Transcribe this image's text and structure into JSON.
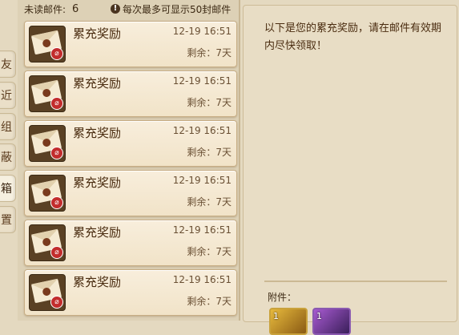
{
  "tabs": [
    {
      "label": "友",
      "active": false
    },
    {
      "label": "近",
      "active": false
    },
    {
      "label": "组",
      "active": false
    },
    {
      "label": "蔽",
      "active": false
    },
    {
      "label": "箱",
      "active": true
    },
    {
      "label": "置",
      "active": false
    }
  ],
  "header": {
    "unread_label": "未读邮件:",
    "unread_count": "6",
    "warn_icon": "!",
    "limit_text": "每次最多可显示50封邮件"
  },
  "mails": [
    {
      "title": "累充奖励",
      "date": "12-19 16:51",
      "remain": "剩余：7天"
    },
    {
      "title": "累充奖励",
      "date": "12-19 16:51",
      "remain": "剩余：7天"
    },
    {
      "title": "累充奖励",
      "date": "12-19 16:51",
      "remain": "剩余：7天"
    },
    {
      "title": "累充奖励",
      "date": "12-19 16:51",
      "remain": "剩余：7天"
    },
    {
      "title": "累充奖励",
      "date": "12-19 16:51",
      "remain": "剩余：7天"
    },
    {
      "title": "累充奖励",
      "date": "12-19 16:51",
      "remain": "剩余：7天"
    }
  ],
  "detail": {
    "message": "以下是您的累充奖励，请在邮件有效期内尽快领取！",
    "attachments_label": "附件：",
    "attachments": [
      {
        "icon": "gold-item-icon",
        "count": "1"
      },
      {
        "icon": "purple-item-icon",
        "count": "1"
      }
    ]
  },
  "colors": {
    "background": "#e4d9c0",
    "mail_card": "#f8eedc",
    "text": "#4a2c10",
    "badge_red": "#c22c2c"
  }
}
